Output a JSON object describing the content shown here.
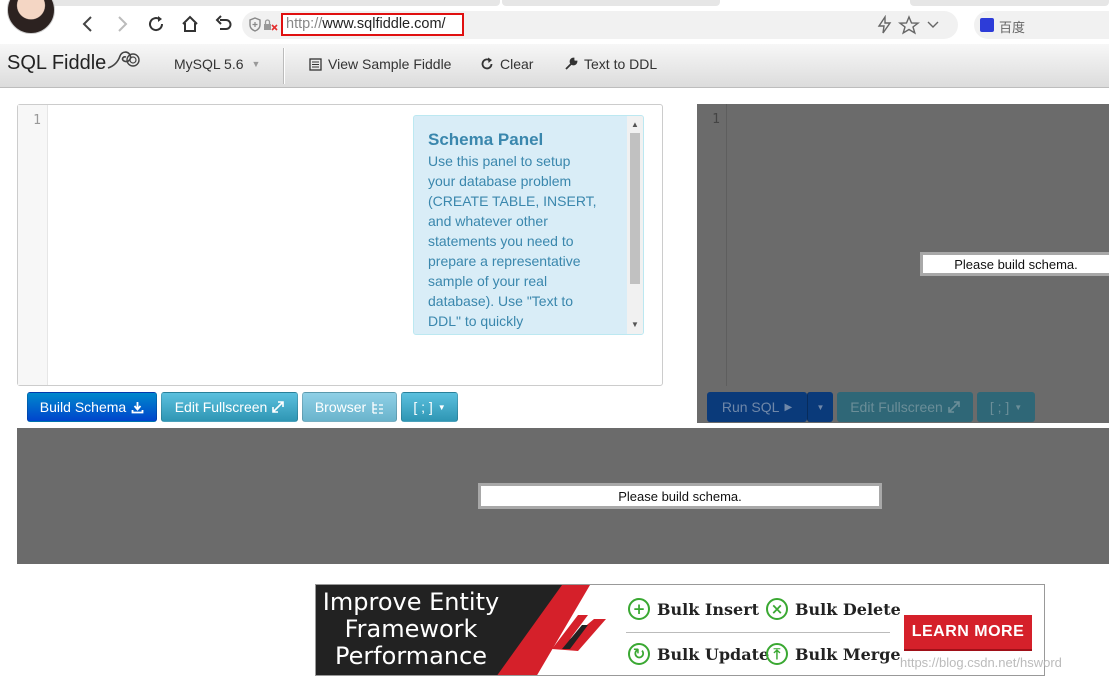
{
  "browser": {
    "url_protocol": "http://",
    "url_rest": "www.sqlfiddle.com/",
    "search_engine_label": "百度"
  },
  "toolbar": {
    "brand": "SQL Fiddle",
    "db_select": "MySQL 5.6",
    "view_sample": "View Sample Fiddle",
    "clear": "Clear",
    "text_to_ddl": "Text to DDL"
  },
  "schema": {
    "line_number": "1",
    "help_title": "Schema Panel",
    "help_text": "Use this panel to setup your database problem (CREATE TABLE, INSERT, and whatever other statements you need to prepare a representative sample of your real database). Use \"Text to DDL\" to quickly",
    "build_button": "Build Schema",
    "fullscreen_button": "Edit Fullscreen",
    "browser_button": "Browser",
    "delimiter_button": "[ ; ]"
  },
  "sql": {
    "line_number": "1",
    "message": "Please build schema.",
    "run_button": "Run SQL",
    "fullscreen_button": "Edit Fullscreen",
    "delimiter_button": "[ ; ]"
  },
  "results": {
    "message": "Please build schema."
  },
  "ad": {
    "headline_lines": [
      "Improve Entity",
      "Framework",
      "Performance"
    ],
    "features": [
      "Bulk Insert",
      "Bulk Delete",
      "Bulk Update",
      "Bulk Merge"
    ],
    "cta": "LEARN MORE"
  },
  "watermark": "https://blog.csdn.net/hsword"
}
